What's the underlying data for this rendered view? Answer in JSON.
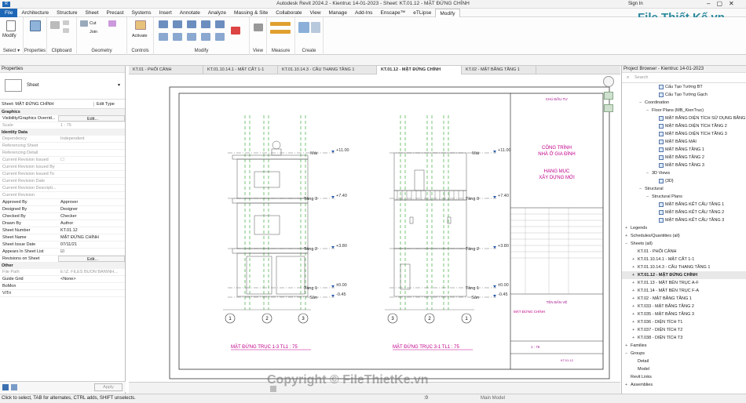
{
  "window": {
    "title": "Autodesk Revit 2024.2 - Kientruc 14-01-2023 - Sheet: KT.01.12 - MẶT ĐỨNG CHÍNH",
    "signin": "Sign In"
  },
  "menu": [
    "File",
    "Architecture",
    "Structure",
    "Sheet",
    "Precast",
    "Systems",
    "Insert",
    "Annotate",
    "Analyze",
    "Massing & Site",
    "Collaborate",
    "View",
    "Manage",
    "Add-Ins",
    "Enscape™",
    "eTLipse",
    "Modify"
  ],
  "ribbon": {
    "groups": [
      "Select",
      "Properties",
      "Clipboard",
      "Geometry",
      "Controls",
      "Modify",
      "View",
      "Measure",
      "Create"
    ],
    "modify_label": "Modify",
    "activate_label": "Activate",
    "cut_label": "Cut",
    "join_label": "Join",
    "select_label": "Select ▾",
    "properties_label": "Properties"
  },
  "tabs": [
    "KT.01 - PHỐI CẢNH",
    "KT.01.10.14.1 - MẶT CẮT 1-1",
    "KT.01.10.14.3 - CẦU THANG TẦNG 1",
    "KT.01.12 - MẶT ĐỨNG CHÍNH",
    "KT.02 - MẶT BẰNG TẦNG 1"
  ],
  "properties": {
    "header": "Properties",
    "type": "Sheet",
    "selector": "Sheet: MẶT ĐỨNG CHÍNH",
    "edit_type": "Edit Type",
    "rows": [
      {
        "cat": "Graphics"
      },
      {
        "k": "Visibility/Graphics Overrid...",
        "v": "Edit..."
      },
      {
        "k": "Scale",
        "v": "1 : 75",
        "g": true
      },
      {
        "cat": "Identity Data"
      },
      {
        "k": "Dependency",
        "v": "Independent",
        "g": true
      },
      {
        "k": "Referencing Sheet",
        "v": "",
        "g": true
      },
      {
        "k": "Referencing Detail",
        "v": "",
        "g": true
      },
      {
        "k": "Current Revision Issued",
        "v": "☐",
        "g": true
      },
      {
        "k": "Current Revision Issued By",
        "v": "",
        "g": true
      },
      {
        "k": "Current Revision Issued To",
        "v": "",
        "g": true
      },
      {
        "k": "Current Revision Date",
        "v": "",
        "g": true
      },
      {
        "k": "Current Revision Descripti...",
        "v": "",
        "g": true
      },
      {
        "k": "Current Revision",
        "v": "",
        "g": true
      },
      {
        "k": "Approved By",
        "v": "Approver"
      },
      {
        "k": "Designed By",
        "v": "Designer"
      },
      {
        "k": "Checked By",
        "v": "Checker"
      },
      {
        "k": "Drawn By",
        "v": "Author"
      },
      {
        "k": "Sheet Number",
        "v": "KT.01.12"
      },
      {
        "k": "Sheet Name",
        "v": "MẶT ĐỨNG CHÍNH"
      },
      {
        "k": "Sheet Issue Date",
        "v": "07/11/21"
      },
      {
        "k": "Appears In Sheet List",
        "v": "☑"
      },
      {
        "k": "Revisions on Sheet",
        "v": "Edit..."
      },
      {
        "cat": "Other"
      },
      {
        "k": "File Path",
        "v": "E:\\Z. FILES BUON BAN\\NH...",
        "g": true
      },
      {
        "k": "Guide Grid",
        "v": "<None>"
      },
      {
        "k": "BoMon",
        "v": ""
      },
      {
        "k": "ViTri",
        "v": ""
      }
    ],
    "apply": "Apply"
  },
  "browser": {
    "header": "Project Browser - Kientruc 14-01-2023",
    "search": "Search",
    "items": [
      {
        "t": "Cấu Tạo Tường BT",
        "l": 4,
        "b": 1
      },
      {
        "t": "Cấu Tạo Tường Gạch",
        "l": 4,
        "b": 1
      },
      {
        "t": "Coordination",
        "l": 2,
        "s": "−"
      },
      {
        "t": "Floor Plans (MB_KienTruc)",
        "l": 3,
        "s": "−"
      },
      {
        "t": "MẶT BẰNG DIỆN TÍCH SỬ DỤNG BẰNG",
        "l": 4,
        "b": 1
      },
      {
        "t": "MẶT BẰNG DIỆN TÍCH TẦNG 2",
        "l": 4,
        "b": 1
      },
      {
        "t": "MẶT BẰNG DIỆN TÍCH TẦNG 3",
        "l": 4,
        "b": 1
      },
      {
        "t": "MẶT BẰNG MÁI",
        "l": 4,
        "b": 1
      },
      {
        "t": "MẶT BẰNG TẦNG 1",
        "l": 4,
        "b": 1
      },
      {
        "t": "MẶT BẰNG TẦNG 2",
        "l": 4,
        "b": 1
      },
      {
        "t": "MẶT BẰNG TẦNG 3",
        "l": 4,
        "b": 1
      },
      {
        "t": "3D Views",
        "l": 3,
        "s": "−"
      },
      {
        "t": "{3D}",
        "l": 4,
        "b": 1
      },
      {
        "t": "Structural",
        "l": 2,
        "s": "−"
      },
      {
        "t": "Structural Plans",
        "l": 3,
        "s": "−"
      },
      {
        "t": "MẶT BẰNG KẾT CẤU TẦNG 1",
        "l": 4,
        "b": 1
      },
      {
        "t": "MẶT BẰNG KẾT CẤU TẦNG 2",
        "l": 4,
        "b": 1
      },
      {
        "t": "MẶT BẰNG KẾT CẤU TẦNG 3",
        "l": 4,
        "b": 1
      },
      {
        "t": "Legends",
        "l": 0,
        "s": "+"
      },
      {
        "t": "Schedules/Quantities (all)",
        "l": 0,
        "s": "+"
      },
      {
        "t": "Sheets (all)",
        "l": 0,
        "s": "−"
      },
      {
        "t": "KT.01 - PHỐI CẢNH",
        "l": 1
      },
      {
        "t": "KT.01.10.14.1 - MẶT CẮT 1-1",
        "l": 1,
        "s": "+"
      },
      {
        "t": "KT.01.10.14.3 - CẦU THANG TẦNG 1",
        "l": 1,
        "s": "+"
      },
      {
        "t": "KT.01.12 - MẶT ĐỨNG CHÍNH",
        "l": 1,
        "s": "+",
        "sel": 1
      },
      {
        "t": "KT.01.13 - MẶT BÊN TRỤC A-F",
        "l": 1,
        "s": "+"
      },
      {
        "t": "KT.01.14 - MẶT BÊN TRỤC F-A",
        "l": 1,
        "s": "+"
      },
      {
        "t": "KT.02 - MẶT BẰNG TẦNG 1",
        "l": 1,
        "s": "+"
      },
      {
        "t": "KT.033 - MẶT BẰNG TẦNG 2",
        "l": 1,
        "s": "+"
      },
      {
        "t": "KT.035 - MẶT BẰNG TẦNG 3",
        "l": 1,
        "s": "+"
      },
      {
        "t": "KT.036 - DIỆN TÍCH T1",
        "l": 1,
        "s": "+"
      },
      {
        "t": "KT.037 - DIỆN TÍCH T2",
        "l": 1,
        "s": "+"
      },
      {
        "t": "KT.038 - DIỆN TÍCH T3",
        "l": 1,
        "s": "+"
      },
      {
        "t": "Families",
        "l": 0,
        "s": "+"
      },
      {
        "t": "Groups",
        "l": 0,
        "s": "−"
      },
      {
        "t": "Detail",
        "l": 1
      },
      {
        "t": "Model",
        "l": 1
      },
      {
        "t": "Revit Links",
        "l": 0
      },
      {
        "t": "Assemblies",
        "l": 0,
        "s": "+"
      }
    ]
  },
  "drawing": {
    "levels": [
      {
        "name": "Mái",
        "elev": "+11.00"
      },
      {
        "name": "Tầng 3",
        "elev": "+7.40"
      },
      {
        "name": "Tầng 2",
        "elev": "+3.80"
      },
      {
        "name": "Tầng 1",
        "elev": "±0.00"
      },
      {
        "name": "Sân",
        "elev": "-0.45"
      }
    ],
    "grids_left": [
      "1",
      "2",
      "3"
    ],
    "grids_right": [
      "3",
      "2",
      "1"
    ],
    "title_left": "MẶT ĐỨNG TRỤC 1-3    TL1 : 75",
    "title_right": "MẶT ĐỨNG TRỤC 3-1    TL1 : 75",
    "tb_owner": "CHỦ ĐẦU TƯ",
    "tb_project_1": "CÔNG TRÌNH",
    "tb_project_2": "NHÀ Ở GIA ĐÌNH",
    "tb_item_1": "HẠNG MỤC",
    "tb_item_2": "XÂY DỰNG MỚI",
    "tb_sheet_label": "TÊN BẢN VẼ",
    "tb_sheet_name": "MẶT ĐỨNG CHÍNH",
    "tb_scale": "1 : 75",
    "tb_number": "KT.01.12"
  },
  "status": {
    "hint": "Click to select, TAB for alternates, CTRL adds, SHIFT unselects.",
    "model": "Main Model",
    "zero": ":0"
  },
  "watermark": "Copyright © FileThietKe.vn",
  "logo": "File Thiết Kế.vn"
}
